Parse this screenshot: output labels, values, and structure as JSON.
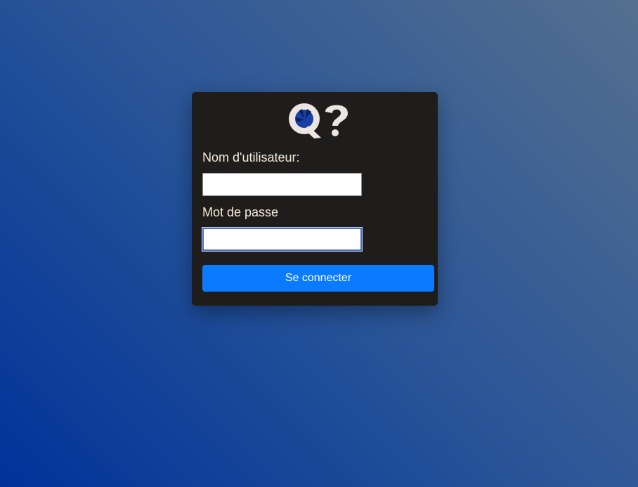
{
  "login": {
    "logo_icon": "q-question-mark-logo",
    "username_label": "Nom d'utilisateur:",
    "username_value": "",
    "password_label": "Mot de passe",
    "password_value": "",
    "submit_label": "Se connecter"
  },
  "colors": {
    "card_background": "#1f1d1c",
    "label_text": "#f5ecd7",
    "button_background": "#0a7bff",
    "logo_fill": "#ece5e0",
    "logo_accent": "#1a3fa8"
  }
}
